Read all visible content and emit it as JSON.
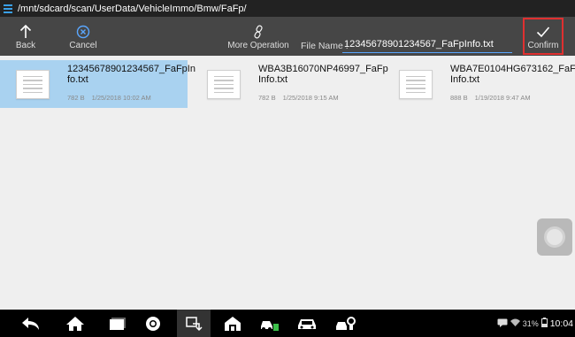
{
  "path": "/mnt/sdcard/scan/UserData/VehicleImmo/Bmw/FaFp/",
  "toolbar": {
    "back_label": "Back",
    "cancel_label": "Cancel",
    "more_label": "More Operation",
    "file_name_label": "File Name :",
    "file_name_value": "12345678901234567_FaFpInfo.txt",
    "confirm_label": "Confirm"
  },
  "files": [
    {
      "name": "12345678901234567_FaFpInfo.txt",
      "size": "782 B",
      "date": "1/25/2018 10:02 AM",
      "selected": true
    },
    {
      "name": "WBA3B16070NP46997_FaFpInfo.txt",
      "size": "782 B",
      "date": "1/25/2018 9:15 AM",
      "selected": false
    },
    {
      "name": "WBA7E0104HG673162_FaFpInfo.txt",
      "size": "888 B",
      "date": "1/19/2018 9:47 AM",
      "selected": false
    }
  ],
  "status": {
    "battery": "31%",
    "time": "10:04"
  },
  "colors": {
    "accent": "#5aa7ff",
    "selection": "#a9d2f0",
    "confirm_outline": "#e03030"
  }
}
